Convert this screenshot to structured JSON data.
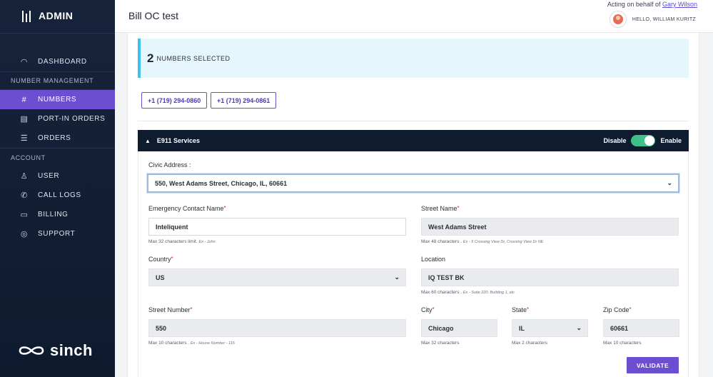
{
  "sidebar": {
    "brand": "ADMIN",
    "items": [
      {
        "label": "DASHBOARD",
        "icon": "gauge-icon"
      },
      {
        "label": "NUMBERS",
        "icon": "hash-icon",
        "active": true
      },
      {
        "label": "PORT-IN ORDERS",
        "icon": "inbox-icon"
      },
      {
        "label": "ORDERS",
        "icon": "list-search-icon"
      },
      {
        "label": "USER",
        "icon": "user-add-icon"
      },
      {
        "label": "CALL LOGS",
        "icon": "phone-icon"
      },
      {
        "label": "BILLING",
        "icon": "card-icon"
      },
      {
        "label": "SUPPORT",
        "icon": "lifebuoy-icon"
      }
    ],
    "sections": {
      "number_management": "NUMBER MANAGEMENT",
      "account": "ACCOUNT"
    },
    "footer_logo": "sinch"
  },
  "header": {
    "title": "Bill OC test",
    "acting_prefix": "Acting on behalf of",
    "acting_user": "Gary Wilson",
    "greeting": "HELLO, WILLIAM KURITZ"
  },
  "selection": {
    "count": "2",
    "label": "NUMBERS SELECTED"
  },
  "numbers": [
    "+1 (719) 294-0860",
    "+1 (719) 294-0861"
  ],
  "e911": {
    "title": "E911 Services",
    "disable_label": "Disable",
    "enable_label": "Enable",
    "enabled": true,
    "civic_label": "Civic Address :",
    "civic_value": "550, West Adams Street, Chicago, IL, 60661",
    "emergency_contact": {
      "label": "Emergency Contact Name",
      "value": "Inteliquent",
      "hint": "Max 32 characters limit.",
      "example": "Ex - John"
    },
    "street_name": {
      "label": "Street Name",
      "value": "West Adams Street",
      "hint": "Max 48 characters .",
      "example": "Ex - 5 Crossing View Dr, Crossing View Dr NE"
    },
    "country": {
      "label": "Country",
      "value": "US"
    },
    "location": {
      "label": "Location",
      "value": "IQ TEST BK",
      "hint": "Max 60 characters .",
      "example": "Ex - Suite 220, Building 1, etc"
    },
    "street_number": {
      "label": "Street Number",
      "value": "550",
      "hint": "Max 10 characters .",
      "example": "Ex - House Number - 115"
    },
    "city": {
      "label": "City",
      "value": "Chicago",
      "hint": "Max 32 characters"
    },
    "state": {
      "label": "State",
      "value": "IL",
      "hint": "Max 2 characters"
    },
    "zip": {
      "label": "Zip Code",
      "value": "60661",
      "hint": "Max 10 characters"
    },
    "validate_label": "VALIDATE"
  },
  "colors": {
    "accent": "#6b4fd0",
    "sidebar": "#16233a",
    "toggle_on": "#3fbf8a",
    "banner": "#e6f6fd"
  }
}
